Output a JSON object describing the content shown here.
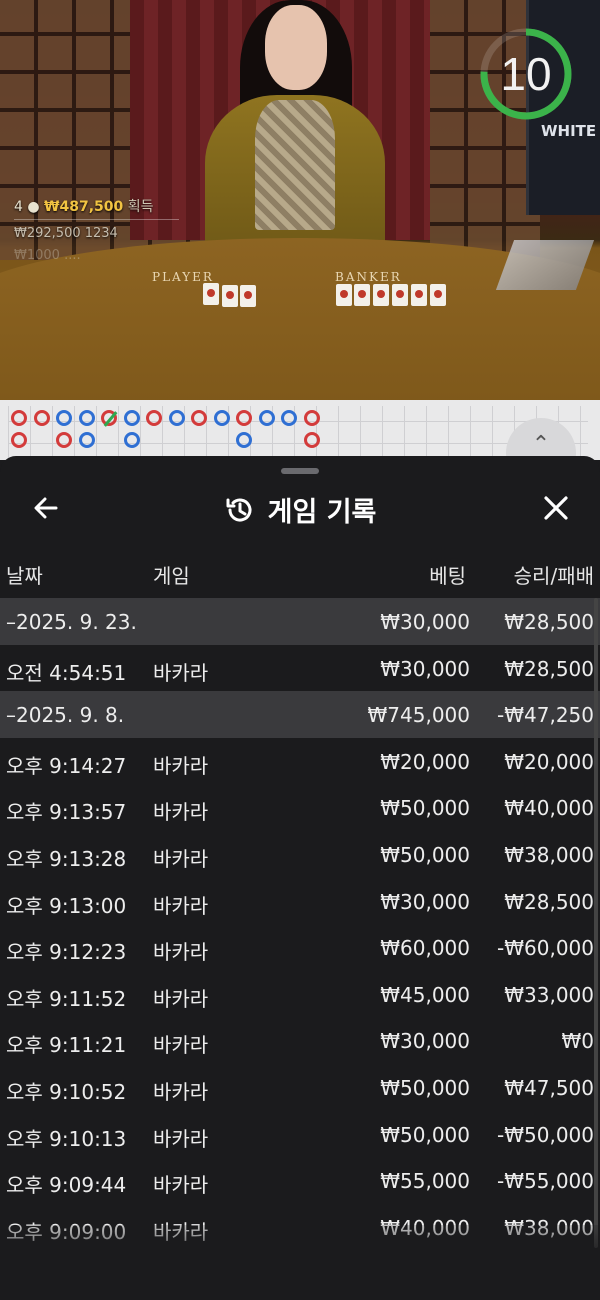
{
  "video": {
    "felt_player": "PLAYER",
    "felt_banker": "BANKER",
    "monitor_text": "WHITE",
    "timer": "10",
    "winners_count": "4",
    "winners_amount": "₩487,500",
    "winners_suffix": "획득",
    "winner_line2": "₩292,500 1234",
    "winner_line3": "₩1000 ...."
  },
  "header": {
    "title": "게임 기록",
    "back_icon": "arrow-left-icon",
    "history_icon": "history-icon",
    "close_icon": "close-icon"
  },
  "columns": {
    "date": "날짜",
    "game": "게임",
    "bet": "베팅",
    "win": "승리/패배"
  },
  "rows": [
    {
      "type": "date",
      "time": "–2025. 9. 23.",
      "game": "",
      "bet": "₩30,000",
      "win": "₩28,500"
    },
    {
      "type": "item",
      "time": "오전 4:54:51",
      "game": "바카라",
      "bet": "₩30,000",
      "win": "₩28,500"
    },
    {
      "type": "date",
      "time": "–2025. 9. 8.",
      "game": "",
      "bet": "₩745,000",
      "win": "-₩47,250"
    },
    {
      "type": "item",
      "time": "오후 9:14:27",
      "game": "바카라",
      "bet": "₩20,000",
      "win": "₩20,000"
    },
    {
      "type": "item",
      "time": "오후 9:13:57",
      "game": "바카라",
      "bet": "₩50,000",
      "win": "₩40,000"
    },
    {
      "type": "item",
      "time": "오후 9:13:28",
      "game": "바카라",
      "bet": "₩50,000",
      "win": "₩38,000"
    },
    {
      "type": "item",
      "time": "오후 9:13:00",
      "game": "바카라",
      "bet": "₩30,000",
      "win": "₩28,500"
    },
    {
      "type": "item",
      "time": "오후 9:12:23",
      "game": "바카라",
      "bet": "₩60,000",
      "win": "-₩60,000"
    },
    {
      "type": "item",
      "time": "오후 9:11:52",
      "game": "바카라",
      "bet": "₩45,000",
      "win": "₩33,000"
    },
    {
      "type": "item",
      "time": "오후 9:11:21",
      "game": "바카라",
      "bet": "₩30,000",
      "win": "₩0"
    },
    {
      "type": "item",
      "time": "오후 9:10:52",
      "game": "바카라",
      "bet": "₩50,000",
      "win": "₩47,500"
    },
    {
      "type": "item",
      "time": "오후 9:10:13",
      "game": "바카라",
      "bet": "₩50,000",
      "win": "-₩50,000"
    },
    {
      "type": "item",
      "time": "오후 9:09:44",
      "game": "바카라",
      "bet": "₩55,000",
      "win": "-₩55,000"
    },
    {
      "type": "item",
      "time": "오후 9:09:00",
      "game": "바카라",
      "bet": "₩40,000",
      "win": "₩38,000"
    }
  ],
  "roadmap": {
    "row1": [
      "red",
      "red",
      "blue",
      "blue",
      "red-tie",
      "blue",
      "red",
      "blue",
      "red",
      "blue",
      "red",
      "blue",
      "blue",
      "red"
    ],
    "row2": [
      "red",
      "",
      "red",
      "blue",
      "",
      "blue",
      "",
      "",
      "",
      "",
      "blue",
      "",
      "",
      "red"
    ]
  }
}
